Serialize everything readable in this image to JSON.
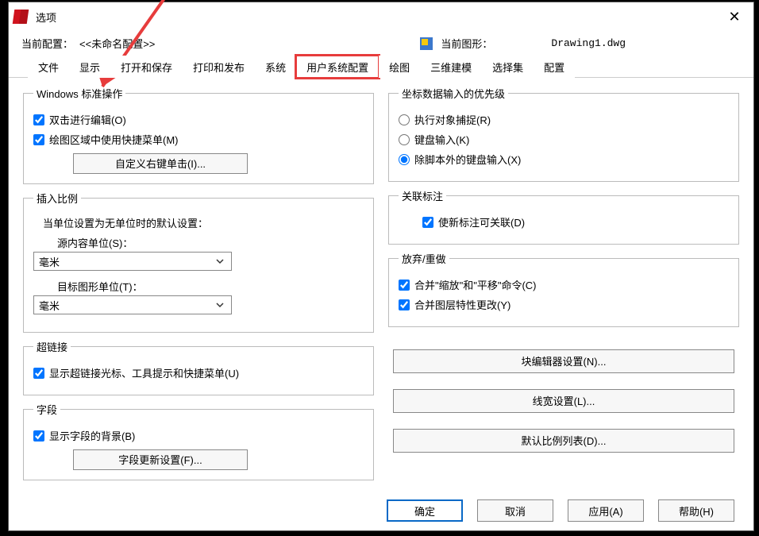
{
  "title": "选项",
  "info": {
    "profile_label": "当前配置：",
    "profile_value": "<<未命名配置>>",
    "drawing_label": "当前图形：",
    "drawing_value": "Drawing1.dwg"
  },
  "tabs": {
    "t0": "文件",
    "t1": "显示",
    "t2": "打开和保存",
    "t3": "打印和发布",
    "t4": "系统",
    "t5": "用户系统配置",
    "t6": "绘图",
    "t7": "三维建模",
    "t8": "选择集",
    "t9": "配置"
  },
  "groups": {
    "winstd": {
      "legend": "Windows 标准操作",
      "dblclick": "双击进行编辑(O)",
      "shortcut_menu": "绘图区域中使用快捷菜单(M)",
      "rclick_btn": "自定义右键单击(I)..."
    },
    "insunits": {
      "legend": "插入比例",
      "desc": "当单位设置为无单位时的默认设置：",
      "src_label": "源内容单位(S)：",
      "src_value": "毫米",
      "tgt_label": "目标图形单位(T)：",
      "tgt_value": "毫米"
    },
    "hyperlink": {
      "legend": "超链接",
      "show": "显示超链接光标、工具提示和快捷菜单(U)"
    },
    "fields": {
      "legend": "字段",
      "show_bg": "显示字段的背景(B)",
      "upd_btn": "字段更新设置(F)..."
    },
    "coordpri": {
      "legend": "坐标数据输入的优先级",
      "r0": "执行对象捕捉(R)",
      "r1": "键盘输入(K)",
      "r2": "除脚本外的键盘输入(X)"
    },
    "assocdim": {
      "legend": "关联标注",
      "chk": "使新标注可关联(D)"
    },
    "undo": {
      "legend": "放弃/重做",
      "chk0": "合并\"缩放\"和\"平移\"命令(C)",
      "chk1": "合并图层特性更改(Y)"
    },
    "extra_btns": {
      "b0": "块编辑器设置(N)...",
      "b1": "线宽设置(L)...",
      "b2": "默认比例列表(D)..."
    }
  },
  "footer": {
    "ok": "确定",
    "cancel": "取消",
    "apply": "应用(A)",
    "help": "帮助(H)"
  }
}
